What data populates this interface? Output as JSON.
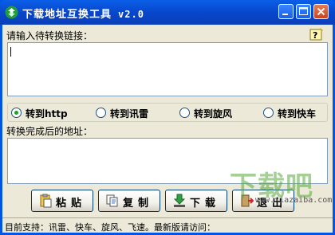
{
  "window": {
    "title": "下载地址互换工具",
    "version": "v2.0"
  },
  "input": {
    "label": "请输入待转换链接：",
    "value": ""
  },
  "radios": [
    {
      "label": "转到http",
      "checked": true
    },
    {
      "label": "转到讯雷",
      "checked": false
    },
    {
      "label": "转到旋风",
      "checked": false
    },
    {
      "label": "转到快车",
      "checked": false
    }
  ],
  "output": {
    "label": "转换完成后的地址：",
    "value": ""
  },
  "buttons": {
    "paste": "粘贴",
    "copy": "复制",
    "download": "下载",
    "exit": "退出"
  },
  "status": {
    "text": "目前支持：讯雷、快车、旋风、飞速。最新版请访问："
  },
  "watermark": {
    "brand": "下载吧",
    "url": "www.xiazaiba.com"
  },
  "colors": {
    "titlebar": "#0845c9",
    "client": "#ece9d8",
    "radio_checked": "#21a121"
  }
}
